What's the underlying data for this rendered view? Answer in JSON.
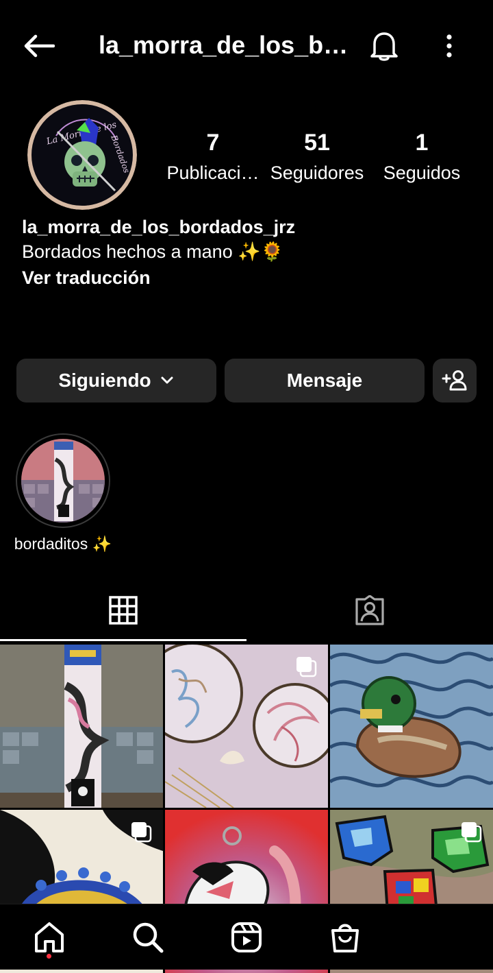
{
  "header": {
    "title": "la_morra_de_los_b…",
    "icons": [
      "back-arrow-icon",
      "bell-icon",
      "more-vertical-icon"
    ]
  },
  "profile": {
    "avatar_text": "La Morra de los Bordados",
    "stats": [
      {
        "value": "7",
        "label": "Publicaci…"
      },
      {
        "value": "51",
        "label": "Seguidores"
      },
      {
        "value": "1",
        "label": "Seguidos"
      }
    ],
    "username": "la_morra_de_los_bordados_jrz",
    "bio": "Bordados hechos a mano ✨🌻",
    "translate": "Ver traducción"
  },
  "actions": {
    "following": "Siguiendo",
    "message": "Mensaje"
  },
  "highlights": [
    {
      "label": "bordaditos ✨"
    }
  ],
  "tabs": [
    "grid-icon",
    "tagged-icon"
  ],
  "colors": {
    "background": "#000000",
    "button": "#262626",
    "notification_dot": "#ff3040"
  },
  "bottom_nav": [
    "home-icon",
    "search-icon",
    "reels-icon",
    "shop-icon"
  ]
}
